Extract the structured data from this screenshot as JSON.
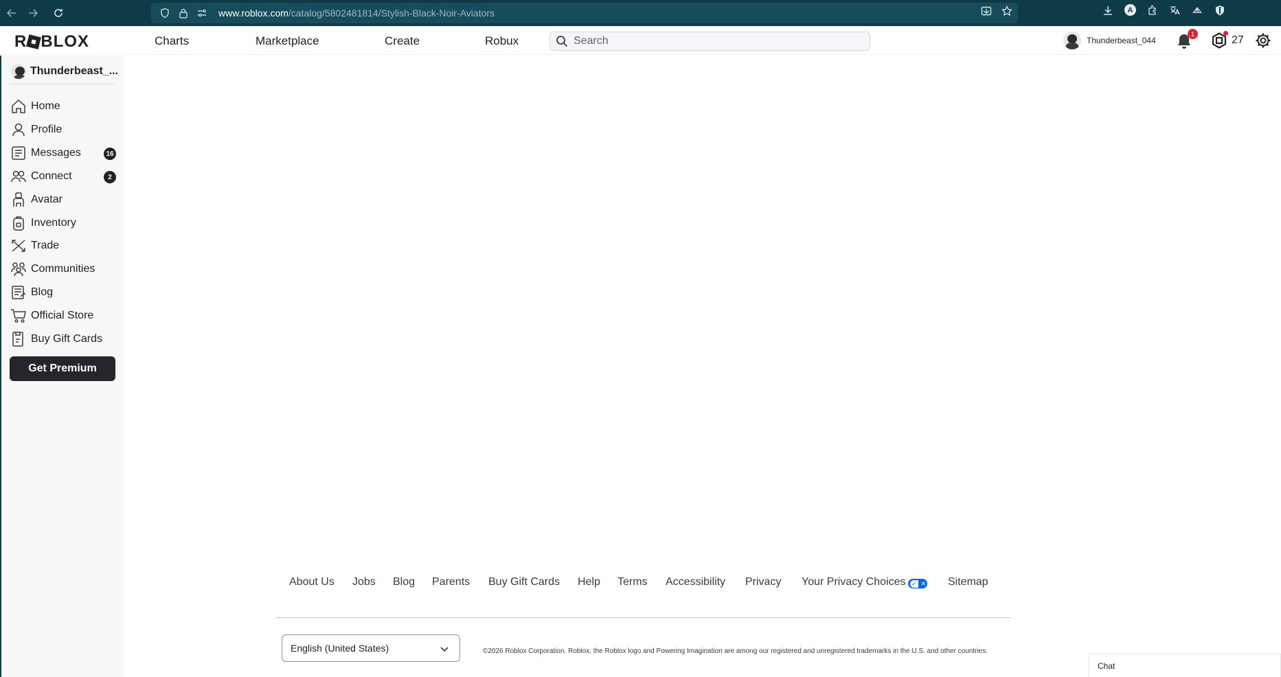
{
  "browser": {
    "url_domain": "www.roblox.com",
    "url_path": "/catalog/5802481814/Stylish-Black-Noir-Aviators"
  },
  "header": {
    "logo": "ROBLOX",
    "nav": [
      "Charts",
      "Marketplace",
      "Create",
      "Robux"
    ],
    "search_placeholder": "Search",
    "username": "Thunderbeast_044",
    "notification_count": "1",
    "robux_balance": "27"
  },
  "sidebar": {
    "username": "Thunderbeast_...",
    "items": [
      {
        "label": "Home",
        "icon": "home-icon"
      },
      {
        "label": "Profile",
        "icon": "profile-icon"
      },
      {
        "label": "Messages",
        "icon": "messages-icon",
        "badge": "16"
      },
      {
        "label": "Connect",
        "icon": "connect-icon",
        "badge": "2"
      },
      {
        "label": "Avatar",
        "icon": "avatar-icon"
      },
      {
        "label": "Inventory",
        "icon": "inventory-icon"
      },
      {
        "label": "Trade",
        "icon": "trade-icon"
      },
      {
        "label": "Communities",
        "icon": "communities-icon"
      },
      {
        "label": "Blog",
        "icon": "blog-icon"
      },
      {
        "label": "Official Store",
        "icon": "store-icon"
      },
      {
        "label": "Buy Gift Cards",
        "icon": "gift-card-icon"
      }
    ],
    "premium_button": "Get Premium"
  },
  "footer": {
    "links": [
      "About Us",
      "Jobs",
      "Blog",
      "Parents",
      "Buy Gift Cards",
      "Help",
      "Terms",
      "Accessibility",
      "Privacy",
      "Your Privacy Choices",
      "Sitemap"
    ],
    "language": "English (United States)",
    "copyright": "©2026 Roblox Corporation. Roblox, the Roblox logo and Powering Imagination are among our registered and unregistered trademarks in the U.S. and other countries."
  },
  "chat": {
    "label": "Chat"
  },
  "colors": {
    "browser_bar": "#0e3b47",
    "sidebar_bg": "#f7f7f8",
    "premium_button": "#24262b",
    "badge": "#202124",
    "notification": "#e0242b",
    "privacy_toggle": "#0066ff"
  }
}
